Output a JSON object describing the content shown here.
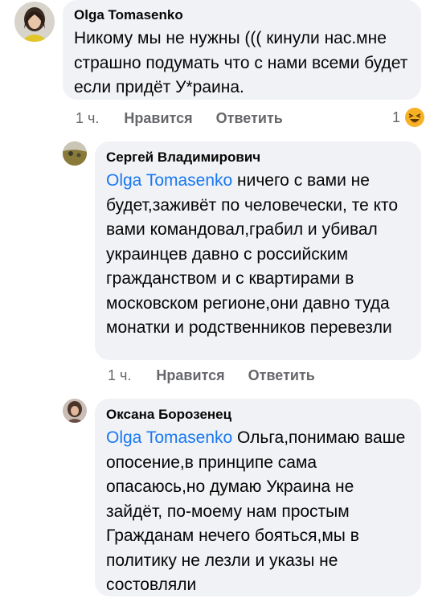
{
  "comments": [
    {
      "author": "Olga Tomasenko",
      "text": "Никому мы не нужны ((( кинули нас.мне страшно подумать что с нами всеми будет если придёт У*раина.",
      "time": "1 ч.",
      "like_label": "Нравится",
      "reply_label": "Ответить",
      "reaction_count": "1",
      "reaction_icon": "laugh-emoji"
    },
    {
      "author": "Сергей Владимирович",
      "mention": "Olga Tomasenko",
      "text": " ничего с вами не будет,заживёт по человечески, те кто вами командовал,грабил и убивал украинцев давно с российским гражданством и с квартирами в московском регионе,они давно туда монатки и родственников перевезли",
      "time": "1 ч.",
      "like_label": "Нравится",
      "reply_label": "Ответить"
    },
    {
      "author": "Оксана Борозенец",
      "mention": "Olga Tomasenko",
      "text": " Ольга,понимаю ваше опосение,в принципе сама опасаюсь,но думаю Украина не зайдёт, по-моему нам простым Гражданам нечего бояться,мы в политику не лезли и указы не состовляли"
    }
  ],
  "colors": {
    "bubble": "#f0f2f5",
    "mention": "#1877f2",
    "secondary_text": "#65676b",
    "reaction": "#f7b125"
  }
}
